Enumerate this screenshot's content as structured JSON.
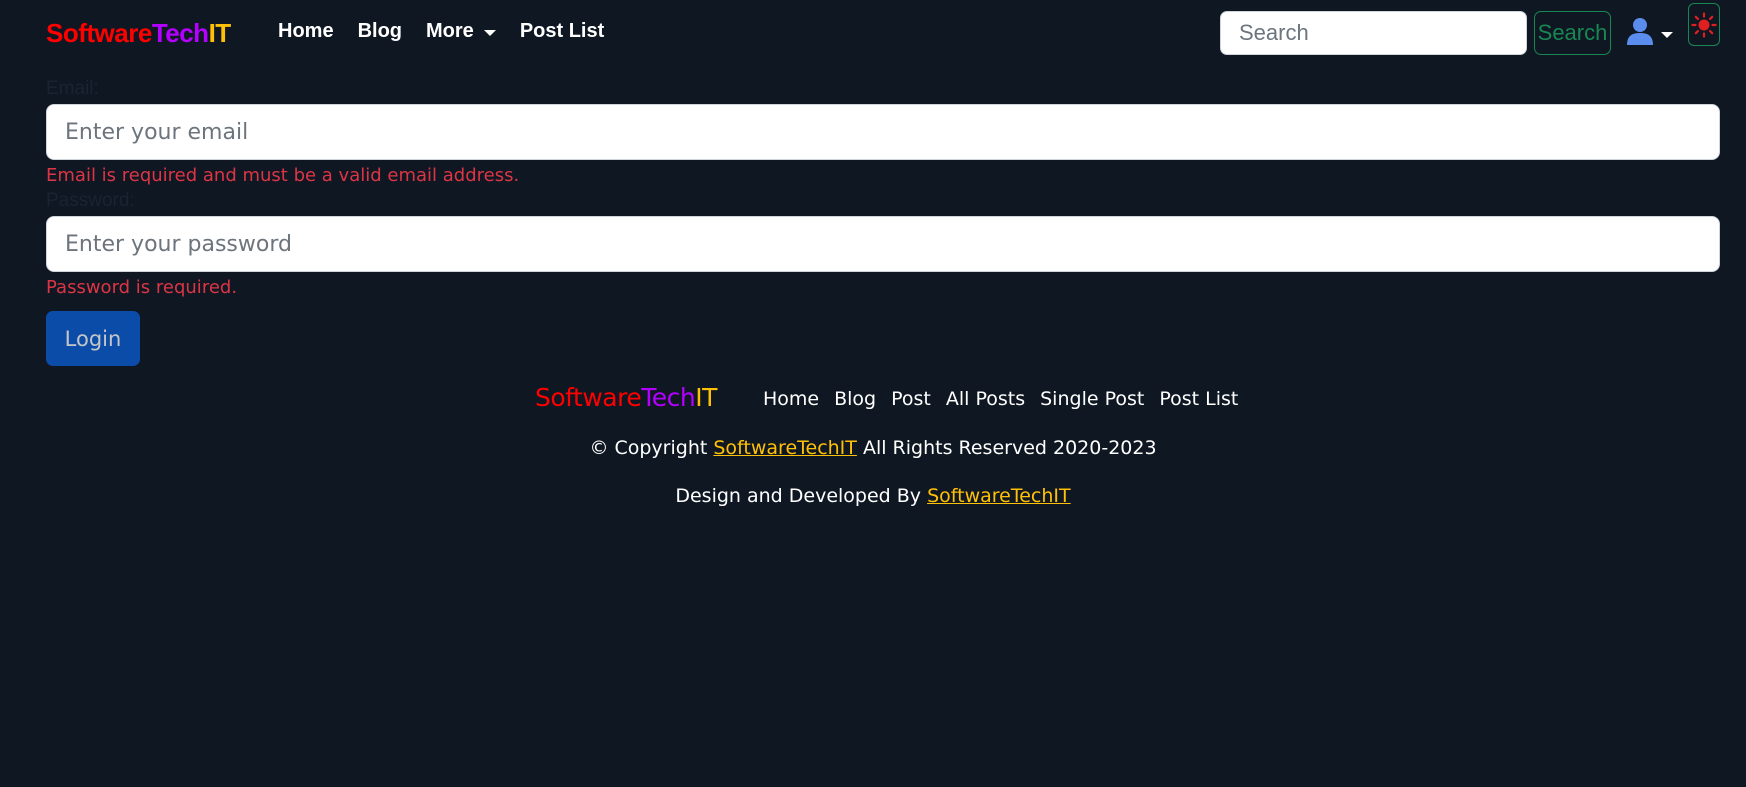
{
  "colors": {
    "brand_software": "#ff0000",
    "brand_tech": "#b300ff",
    "brand_it": "#ffc107",
    "error": "#dc3545",
    "primary": "#0b5ed7",
    "success": "#198754"
  },
  "navbar": {
    "brand": {
      "part1": "Software",
      "part2": "Tech",
      "part3": "IT"
    },
    "links": [
      {
        "label": "Home"
      },
      {
        "label": "Blog"
      },
      {
        "label": "More",
        "has_dropdown": true
      },
      {
        "label": "Post List"
      }
    ],
    "search": {
      "placeholder": "Search",
      "value": "",
      "button_label": "Search"
    },
    "user_icon": "user-icon",
    "theme_icon": "sun-icon"
  },
  "form": {
    "email": {
      "label": "Email:",
      "placeholder": "Enter your email",
      "value": "",
      "error": "Email is required and must be a valid email address."
    },
    "password": {
      "label": "Password:",
      "placeholder": "Enter your password",
      "value": "",
      "error": "Password is required."
    },
    "submit_label": "Login"
  },
  "footer": {
    "brand": {
      "part1": "Software",
      "part2": "Tech",
      "part3": "IT"
    },
    "links": [
      {
        "label": "Home"
      },
      {
        "label": "Blog"
      },
      {
        "label": "Post"
      },
      {
        "label": "All Posts"
      },
      {
        "label": "Single Post"
      },
      {
        "label": "Post List"
      }
    ],
    "copyright": {
      "prefix": "© Copyright",
      "link": "SoftwareTechIT",
      "suffix": "All Rights Reserved 2020-2023"
    },
    "credit": {
      "prefix": "Design and Developed By",
      "link": "SoftwareTechIT"
    }
  }
}
